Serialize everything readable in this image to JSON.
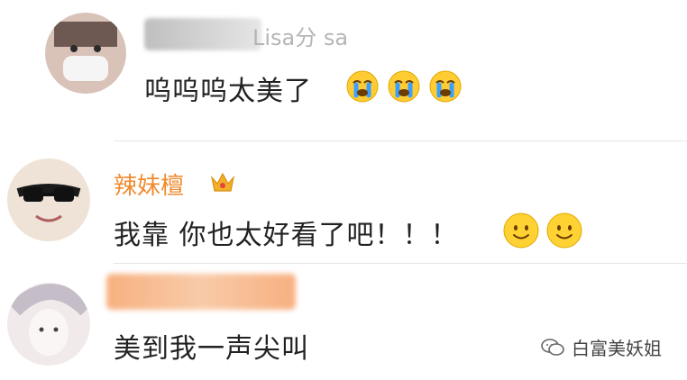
{
  "comments": [
    {
      "name_visible": "Lisa分 sa",
      "text": "呜呜呜太美了",
      "emoji": [
        "crying-emoji",
        "crying-emoji",
        "crying-emoji"
      ]
    },
    {
      "name_visible": "辣妹檀",
      "text": "我靠 你也太好看了吧！！！",
      "emoji": [
        "smile-emoji",
        "smile-emoji"
      ]
    },
    {
      "name_visible": "",
      "text": "美到我一声尖叫",
      "emoji": []
    }
  ],
  "watermark": {
    "label": "白富美妖姐"
  },
  "colors": {
    "username": "#f08a2e",
    "text": "#222222",
    "divider": "#e6e6e6",
    "crown": "#e8a624"
  }
}
